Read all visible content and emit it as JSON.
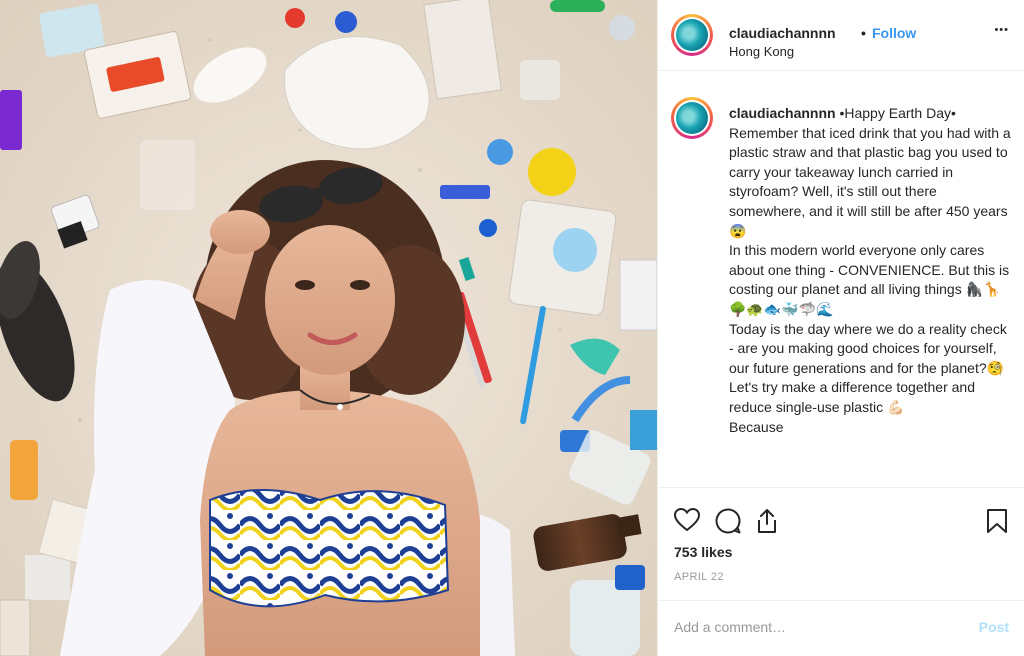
{
  "header": {
    "username": "claudiachannnn",
    "separator": "•",
    "follow_label": "Follow",
    "location": "Hong Kong",
    "more_label": "•••"
  },
  "caption": {
    "username": "claudiachannnn",
    "text": " •Happy Earth Day• Remember that iced drink that you had with a plastic straw and that plastic bag you used to carry your takeaway lunch carried in styrofoam? Well, it's still out there somewhere, and it will still be after 450 years 😨\nIn this modern world everyone only cares about one thing - CONVENIENCE. But this is costing our planet and all living things 🦍🦒\n🌳🐢🐟🐳🦈🌊\nToday is the day where we do a reality check - are you making good choices for yourself, our future generations and for the planet?🧐\nLet's try make a difference together and reduce single-use plastic 💪🏻\nBecause"
  },
  "actions": {
    "like_icon": "heart-icon",
    "comment_icon": "comment-icon",
    "share_icon": "share-icon",
    "save_icon": "bookmark-icon"
  },
  "likes": "753 likes",
  "date": "APRIL 22",
  "comment": {
    "placeholder": "Add a comment…",
    "post_label": "Post"
  },
  "colors": {
    "link_blue": "#3897f0",
    "post_disabled": "#b2dffc",
    "text": "#262626",
    "muted": "#999999"
  }
}
